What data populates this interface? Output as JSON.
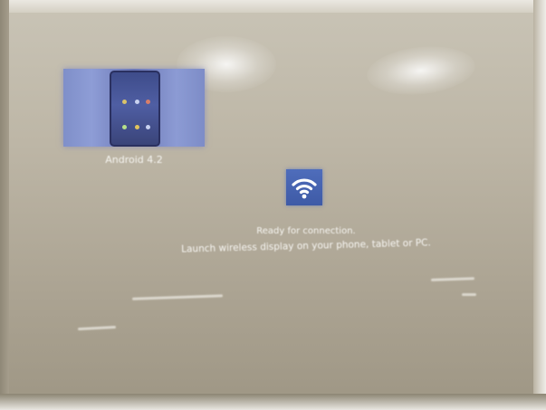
{
  "projection": {
    "thumbnail_caption": "Android 4.2",
    "message_line_1": "Ready for connection.",
    "message_line_2": "Launch wireless display on your phone, tablet or PC.",
    "icon": "wifi-icon",
    "colors": {
      "wall": "#b8b1a1",
      "icon_tile": "#4a63b0",
      "thumbnail": "#7f8fc9",
      "text": "#f7f6f2"
    }
  }
}
